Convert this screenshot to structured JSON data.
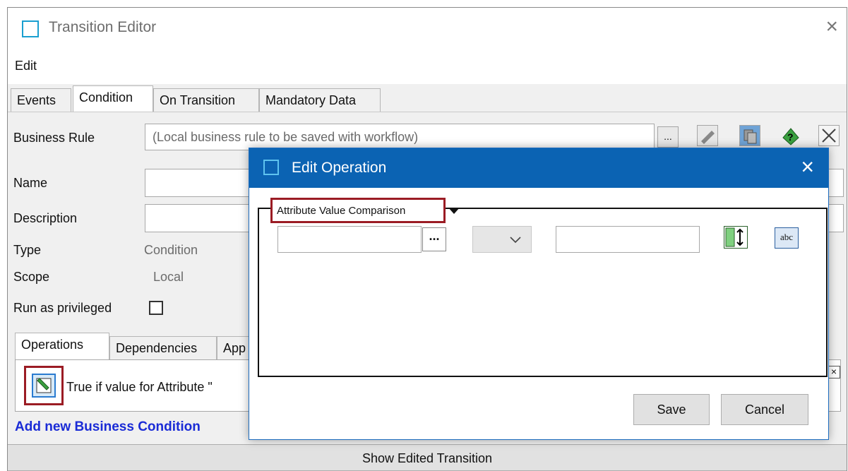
{
  "window": {
    "title": "Transition Editor",
    "close_glyph": "×"
  },
  "menu": {
    "edit": "Edit"
  },
  "tabs": [
    {
      "label": "Events"
    },
    {
      "label": "Condition"
    },
    {
      "label": "On Transition"
    },
    {
      "label": "Mandatory Data"
    }
  ],
  "form": {
    "business_rule_label": "Business Rule",
    "business_rule_value": "(Local business rule to be saved with workflow)",
    "browse_label": "...",
    "name_label": "Name",
    "description_label": "Description",
    "type_label": "Type",
    "type_value": "Condition",
    "scope_label": "Scope",
    "scope_value": "Local",
    "run_privileged_label": "Run as privileged"
  },
  "subtabs": [
    {
      "label": "Operations"
    },
    {
      "label": "Dependencies"
    },
    {
      "label": "App"
    }
  ],
  "operations_list": {
    "item_text": "True if value for Attribute \""
  },
  "add_condition_link": "Add new Business Condition",
  "footer_button": "Show Edited Transition",
  "dialog": {
    "title": "Edit Operation",
    "close_glyph": "×",
    "operation_type": "Attribute Value Comparison",
    "browse_label": "...",
    "operator_value": "",
    "attribute_value": "",
    "compare_value": "",
    "abc_label": "abc",
    "save_label": "Save",
    "cancel_label": "Cancel"
  },
  "colors": {
    "accent": "#0b63b3",
    "highlight": "#9b1c24",
    "link": "#1a2bd6"
  },
  "icons": [
    "app-window-icon",
    "close-icon",
    "edit-condition-icon",
    "help-icon",
    "delete-icon",
    "copy-icon",
    "field-size-icon",
    "text-type-icon",
    "dropdown-arrow-icon"
  ]
}
